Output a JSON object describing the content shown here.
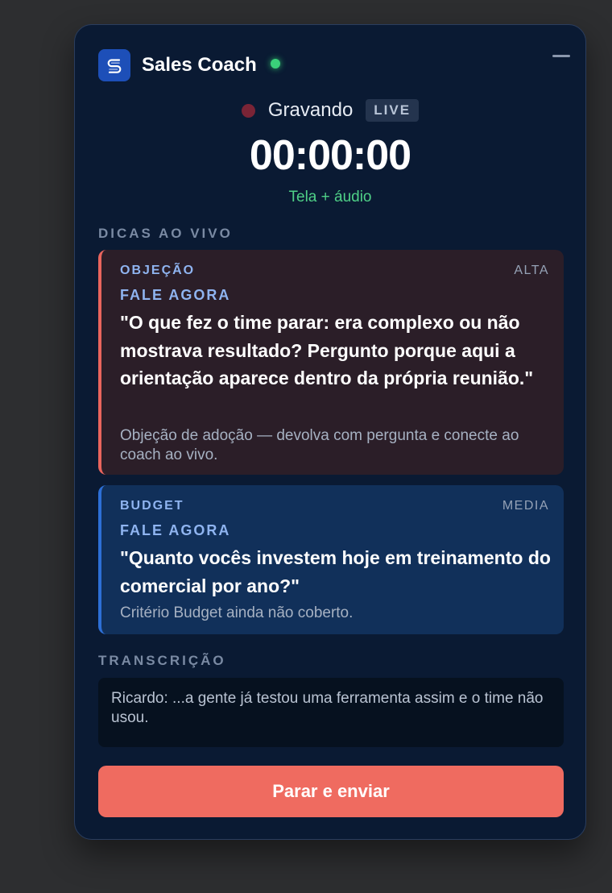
{
  "app": {
    "title": "Sales Coach",
    "logo_letter": "S",
    "online_status_color": "#3ad07a",
    "accent_color": "#1d4fb8"
  },
  "recording": {
    "status_label": "Gravando",
    "live_badge": "LIVE",
    "timer": "00:00:00",
    "source": "Tela + áudio"
  },
  "tips_section": {
    "label": "DICAS AO VIVO",
    "tips": [
      {
        "type": "OBJEÇÃO",
        "priority": "ALTA",
        "action": "FALE AGORA",
        "quote": "\"O que fez o time parar: era complexo ou não mostrava resultado? Pergunto porque aqui a orientação aparece dentro da própria reunião.\"",
        "note": "Objeção de adoção — devolva com pergunta e conecte ao coach ao vivo.",
        "accent_color": "#e9655d"
      },
      {
        "type": "BUDGET",
        "priority": "MEDIA",
        "action": "FALE AGORA",
        "quote": "\"Quanto vocês investem hoje em treinamento do comercial por ano?\"",
        "note": "Critério Budget ainda não coberto.",
        "accent_color": "#2d6fd6"
      }
    ]
  },
  "transcript_section": {
    "label": "TRANSCRIÇÃO",
    "text": "Ricardo: ...a gente já testou uma ferramenta assim e o time não usou."
  },
  "actions": {
    "stop_button": "Parar e enviar",
    "stop_button_color": "#ef6b60"
  },
  "icons": {
    "logo": "s-logo-icon",
    "minimize": "minimize-icon",
    "recording": "recording-dot-icon",
    "online": "online-status-dot"
  }
}
